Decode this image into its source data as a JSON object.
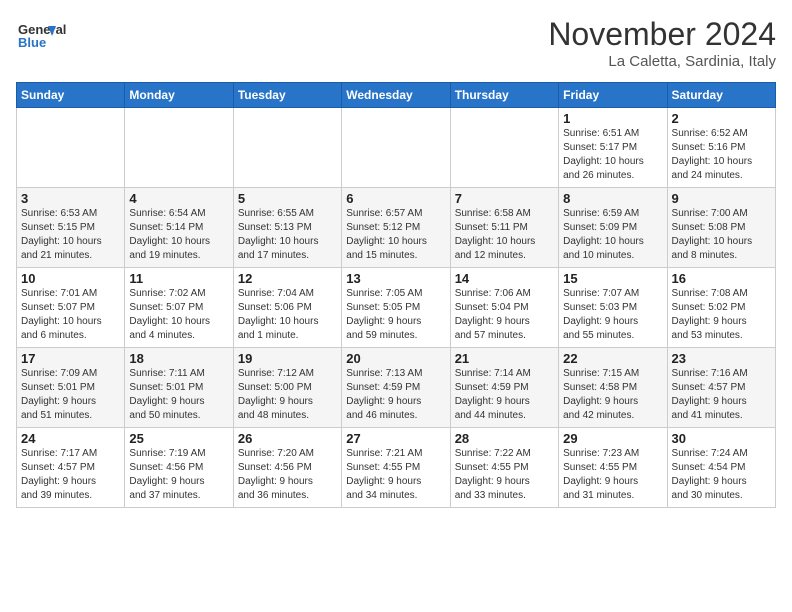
{
  "header": {
    "logo_line1": "General",
    "logo_line2": "Blue",
    "month": "November 2024",
    "location": "La Caletta, Sardinia, Italy"
  },
  "weekdays": [
    "Sunday",
    "Monday",
    "Tuesday",
    "Wednesday",
    "Thursday",
    "Friday",
    "Saturday"
  ],
  "weeks": [
    [
      {
        "day": "",
        "info": ""
      },
      {
        "day": "",
        "info": ""
      },
      {
        "day": "",
        "info": ""
      },
      {
        "day": "",
        "info": ""
      },
      {
        "day": "",
        "info": ""
      },
      {
        "day": "1",
        "info": "Sunrise: 6:51 AM\nSunset: 5:17 PM\nDaylight: 10 hours\nand 26 minutes."
      },
      {
        "day": "2",
        "info": "Sunrise: 6:52 AM\nSunset: 5:16 PM\nDaylight: 10 hours\nand 24 minutes."
      }
    ],
    [
      {
        "day": "3",
        "info": "Sunrise: 6:53 AM\nSunset: 5:15 PM\nDaylight: 10 hours\nand 21 minutes."
      },
      {
        "day": "4",
        "info": "Sunrise: 6:54 AM\nSunset: 5:14 PM\nDaylight: 10 hours\nand 19 minutes."
      },
      {
        "day": "5",
        "info": "Sunrise: 6:55 AM\nSunset: 5:13 PM\nDaylight: 10 hours\nand 17 minutes."
      },
      {
        "day": "6",
        "info": "Sunrise: 6:57 AM\nSunset: 5:12 PM\nDaylight: 10 hours\nand 15 minutes."
      },
      {
        "day": "7",
        "info": "Sunrise: 6:58 AM\nSunset: 5:11 PM\nDaylight: 10 hours\nand 12 minutes."
      },
      {
        "day": "8",
        "info": "Sunrise: 6:59 AM\nSunset: 5:09 PM\nDaylight: 10 hours\nand 10 minutes."
      },
      {
        "day": "9",
        "info": "Sunrise: 7:00 AM\nSunset: 5:08 PM\nDaylight: 10 hours\nand 8 minutes."
      }
    ],
    [
      {
        "day": "10",
        "info": "Sunrise: 7:01 AM\nSunset: 5:07 PM\nDaylight: 10 hours\nand 6 minutes."
      },
      {
        "day": "11",
        "info": "Sunrise: 7:02 AM\nSunset: 5:07 PM\nDaylight: 10 hours\nand 4 minutes."
      },
      {
        "day": "12",
        "info": "Sunrise: 7:04 AM\nSunset: 5:06 PM\nDaylight: 10 hours\nand 1 minute."
      },
      {
        "day": "13",
        "info": "Sunrise: 7:05 AM\nSunset: 5:05 PM\nDaylight: 9 hours\nand 59 minutes."
      },
      {
        "day": "14",
        "info": "Sunrise: 7:06 AM\nSunset: 5:04 PM\nDaylight: 9 hours\nand 57 minutes."
      },
      {
        "day": "15",
        "info": "Sunrise: 7:07 AM\nSunset: 5:03 PM\nDaylight: 9 hours\nand 55 minutes."
      },
      {
        "day": "16",
        "info": "Sunrise: 7:08 AM\nSunset: 5:02 PM\nDaylight: 9 hours\nand 53 minutes."
      }
    ],
    [
      {
        "day": "17",
        "info": "Sunrise: 7:09 AM\nSunset: 5:01 PM\nDaylight: 9 hours\nand 51 minutes."
      },
      {
        "day": "18",
        "info": "Sunrise: 7:11 AM\nSunset: 5:01 PM\nDaylight: 9 hours\nand 50 minutes."
      },
      {
        "day": "19",
        "info": "Sunrise: 7:12 AM\nSunset: 5:00 PM\nDaylight: 9 hours\nand 48 minutes."
      },
      {
        "day": "20",
        "info": "Sunrise: 7:13 AM\nSunset: 4:59 PM\nDaylight: 9 hours\nand 46 minutes."
      },
      {
        "day": "21",
        "info": "Sunrise: 7:14 AM\nSunset: 4:59 PM\nDaylight: 9 hours\nand 44 minutes."
      },
      {
        "day": "22",
        "info": "Sunrise: 7:15 AM\nSunset: 4:58 PM\nDaylight: 9 hours\nand 42 minutes."
      },
      {
        "day": "23",
        "info": "Sunrise: 7:16 AM\nSunset: 4:57 PM\nDaylight: 9 hours\nand 41 minutes."
      }
    ],
    [
      {
        "day": "24",
        "info": "Sunrise: 7:17 AM\nSunset: 4:57 PM\nDaylight: 9 hours\nand 39 minutes."
      },
      {
        "day": "25",
        "info": "Sunrise: 7:19 AM\nSunset: 4:56 PM\nDaylight: 9 hours\nand 37 minutes."
      },
      {
        "day": "26",
        "info": "Sunrise: 7:20 AM\nSunset: 4:56 PM\nDaylight: 9 hours\nand 36 minutes."
      },
      {
        "day": "27",
        "info": "Sunrise: 7:21 AM\nSunset: 4:55 PM\nDaylight: 9 hours\nand 34 minutes."
      },
      {
        "day": "28",
        "info": "Sunrise: 7:22 AM\nSunset: 4:55 PM\nDaylight: 9 hours\nand 33 minutes."
      },
      {
        "day": "29",
        "info": "Sunrise: 7:23 AM\nSunset: 4:55 PM\nDaylight: 9 hours\nand 31 minutes."
      },
      {
        "day": "30",
        "info": "Sunrise: 7:24 AM\nSunset: 4:54 PM\nDaylight: 9 hours\nand 30 minutes."
      }
    ]
  ]
}
